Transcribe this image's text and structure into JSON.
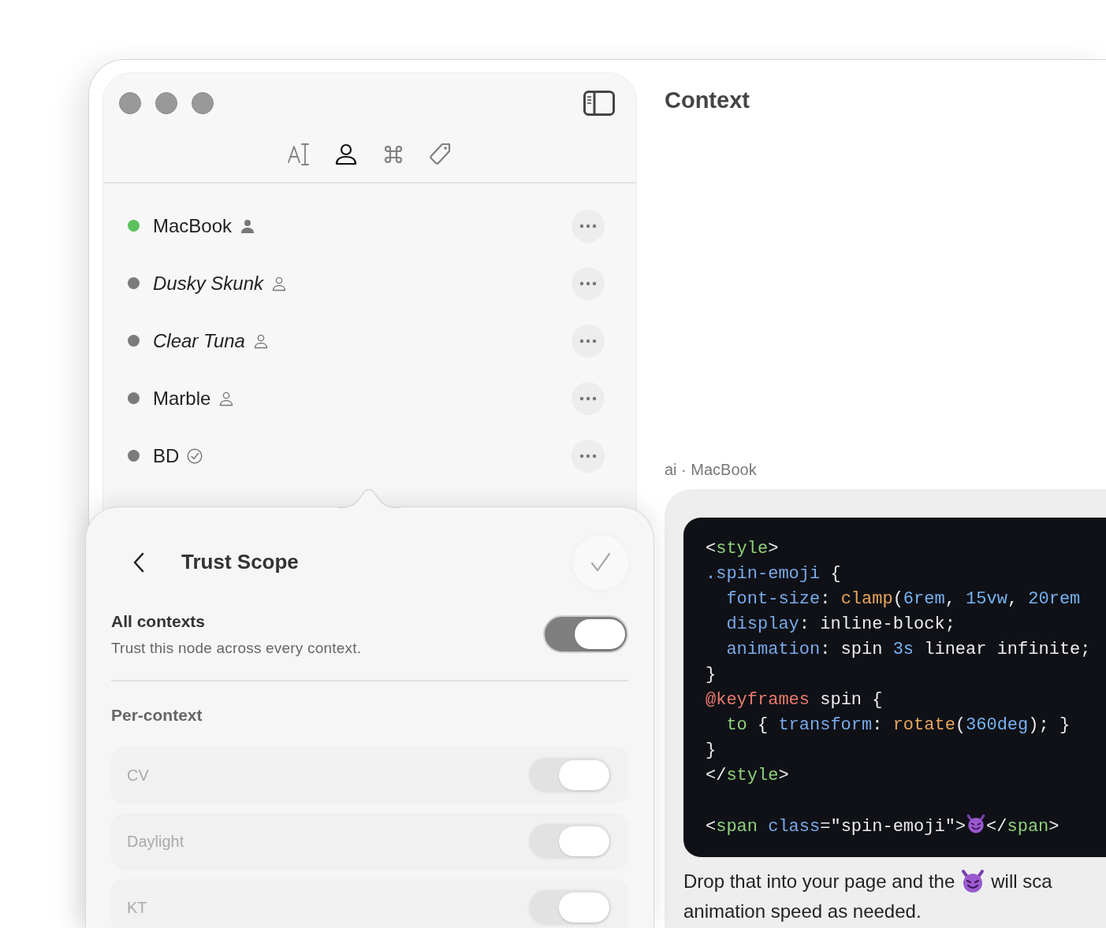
{
  "sidebar": {
    "tabs": [
      {
        "kind": "text",
        "selected": false
      },
      {
        "kind": "person",
        "selected": true
      },
      {
        "kind": "command",
        "selected": false
      },
      {
        "kind": "tag",
        "selected": false
      }
    ],
    "nodes": [
      {
        "name": "MacBook",
        "italic": false,
        "color": "#5cc15d",
        "kind": "person-filled"
      },
      {
        "name": "Dusky Skunk",
        "italic": true,
        "color": "#7b7b7b",
        "kind": "person"
      },
      {
        "name": "Clear Tuna",
        "italic": true,
        "color": "#7b7b7b",
        "kind": "person"
      },
      {
        "name": "Marble",
        "italic": false,
        "color": "#7b7b7b",
        "kind": "person"
      },
      {
        "name": "BD",
        "italic": false,
        "color": "#7b7b7b",
        "kind": "check-circle"
      }
    ]
  },
  "popover": {
    "title": "Trust Scope",
    "all_contexts": {
      "label": "All contexts",
      "description": "Trust this node across every context.",
      "on": true
    },
    "section_label": "Per-context",
    "contexts": [
      {
        "name": "CV",
        "on": true,
        "disabled": true
      },
      {
        "name": "Daylight",
        "on": true,
        "disabled": true
      },
      {
        "name": "KT",
        "on": true,
        "disabled": true
      }
    ]
  },
  "main": {
    "title": "Context",
    "sender": "ai · MacBook",
    "code_groups": [
      [
        {
          "indented": false,
          "tokens": [
            {
              "kind": "plain",
              "text": "<"
            },
            {
              "kind": "tag",
              "text": "style"
            },
            {
              "kind": "plain",
              "text": ">"
            }
          ]
        },
        {
          "indented": false,
          "tokens": [
            {
              "kind": "prop",
              "text": ".spin-emoji"
            },
            {
              "kind": "plain",
              "text": " {"
            }
          ]
        },
        {
          "indented": true,
          "tokens": [
            {
              "kind": "prop",
              "text": "font-size"
            },
            {
              "kind": "plain",
              "text": ": "
            },
            {
              "kind": "func",
              "text": "clamp"
            },
            {
              "kind": "plain",
              "text": "("
            },
            {
              "kind": "num",
              "text": "6rem"
            },
            {
              "kind": "plain",
              "text": ", "
            },
            {
              "kind": "num",
              "text": "15vw"
            },
            {
              "kind": "plain",
              "text": ", "
            },
            {
              "kind": "num",
              "text": "20rem"
            }
          ]
        },
        {
          "indented": true,
          "tokens": [
            {
              "kind": "prop",
              "text": "display"
            },
            {
              "kind": "plain",
              "text": ": inline-block;"
            }
          ]
        },
        {
          "indented": true,
          "tokens": [
            {
              "kind": "prop",
              "text": "animation"
            },
            {
              "kind": "plain",
              "text": ": spin "
            },
            {
              "kind": "num",
              "text": "3s"
            },
            {
              "kind": "plain",
              "text": " linear infinite;"
            }
          ]
        },
        {
          "indented": false,
          "tokens": [
            {
              "kind": "plain",
              "text": "}"
            }
          ]
        },
        {
          "indented": false,
          "tokens": [
            {
              "kind": "at",
              "text": "@keyframes"
            },
            {
              "kind": "plain",
              "text": " spin {"
            }
          ]
        },
        {
          "indented": true,
          "tokens": [
            {
              "kind": "tag",
              "text": "to"
            },
            {
              "kind": "plain",
              "text": " { "
            },
            {
              "kind": "prop",
              "text": "transform"
            },
            {
              "kind": "plain",
              "text": ": "
            },
            {
              "kind": "func",
              "text": "rotate"
            },
            {
              "kind": "plain",
              "text": "("
            },
            {
              "kind": "num",
              "text": "360deg"
            },
            {
              "kind": "plain",
              "text": "); }"
            }
          ]
        },
        {
          "indented": false,
          "tokens": [
            {
              "kind": "plain",
              "text": "}"
            }
          ]
        },
        {
          "indented": false,
          "tokens": [
            {
              "kind": "plain",
              "text": "</"
            },
            {
              "kind": "tag",
              "text": "style"
            },
            {
              "kind": "plain",
              "text": ">"
            }
          ]
        }
      ],
      [
        {
          "indented": false,
          "tokens": [
            {
              "kind": "plain",
              "text": "<"
            },
            {
              "kind": "tag",
              "text": "span"
            },
            {
              "kind": "prop",
              "text": " class"
            },
            {
              "kind": "plain",
              "text": "=\"spin-emoji\">"
            },
            {
              "kind": "emoji"
            },
            {
              "kind": "plain",
              "text": "</"
            },
            {
              "kind": "tag",
              "text": "span"
            },
            {
              "kind": "plain",
              "text": ">"
            }
          ]
        }
      ]
    ],
    "text_lines": [
      [
        {
          "kind": "text",
          "text": "Drop that into your page and the"
        },
        {
          "kind": "emoji"
        },
        {
          "kind": "text",
          "text": "will sca"
        }
      ],
      [
        {
          "kind": "text",
          "text": "animation speed as needed."
        }
      ]
    ]
  }
}
